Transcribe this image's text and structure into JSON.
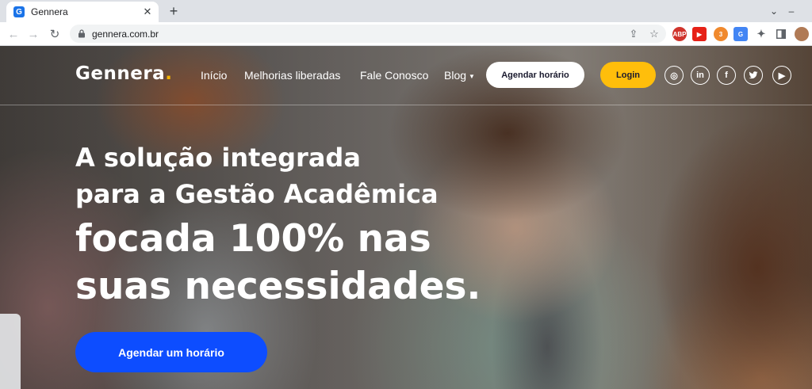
{
  "browser": {
    "tab_title": "Gennera",
    "favicon_letter": "G",
    "url": "gennera.com.br",
    "extensions": [
      {
        "name": "abp",
        "label": "ABP",
        "color": "#d0342c"
      },
      {
        "name": "youtube",
        "label": "▶",
        "color": "#e62117"
      },
      {
        "name": "extension-badge",
        "label": "3",
        "color": "#f0892d"
      },
      {
        "name": "translate",
        "label": "G",
        "color": "#4285f4"
      }
    ]
  },
  "site": {
    "logo": "Gennera",
    "nav": {
      "inicio": "Início",
      "melhorias": "Melhorias liberadas",
      "fale": "Fale Conosco",
      "blog": "Blog"
    },
    "agendar_nav": "Agendar horário",
    "login": "Login",
    "social": {
      "instagram": "◎",
      "linkedin": "in",
      "facebook": "f",
      "twitter": "🐦",
      "youtube": "▶"
    }
  },
  "hero": {
    "line1": "A solução integrada",
    "line2": "para a Gestão Acadêmica",
    "line3": "focada 100% nas",
    "line4": "suas necessidades.",
    "cta": "Agendar um horário"
  }
}
